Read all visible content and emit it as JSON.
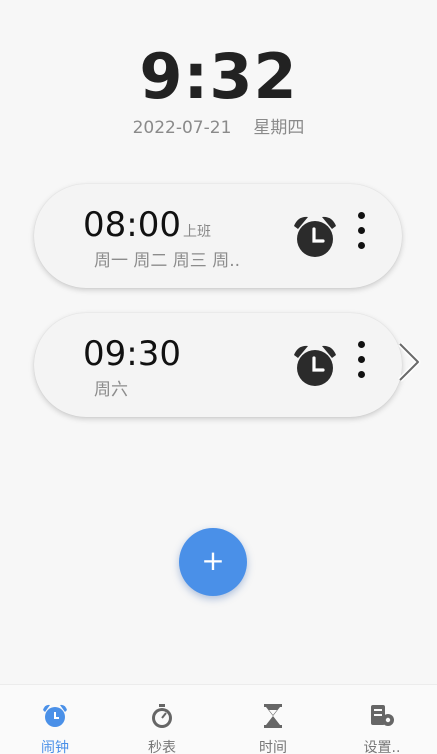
{
  "header": {
    "time": "9:32",
    "date": "2022-07-21",
    "weekday": "星期四"
  },
  "alarms": [
    {
      "time": "08:00",
      "label": "上班",
      "days": "周一 周二 周三 周.."
    },
    {
      "time": "09:30",
      "label": "",
      "days": "周六"
    }
  ],
  "fab": {
    "label": "+"
  },
  "tabs": [
    {
      "label": "闹钟",
      "icon": "alarm-clock-icon",
      "active": true
    },
    {
      "label": "秒表",
      "icon": "stopwatch-icon",
      "active": false
    },
    {
      "label": "时间",
      "icon": "hourglass-icon",
      "active": false
    },
    {
      "label": "设置..",
      "icon": "settings-icon",
      "active": false
    }
  ],
  "colors": {
    "accent": "#4a90e8",
    "inactive_tab": "#777777",
    "background": "#f7f7f7"
  }
}
